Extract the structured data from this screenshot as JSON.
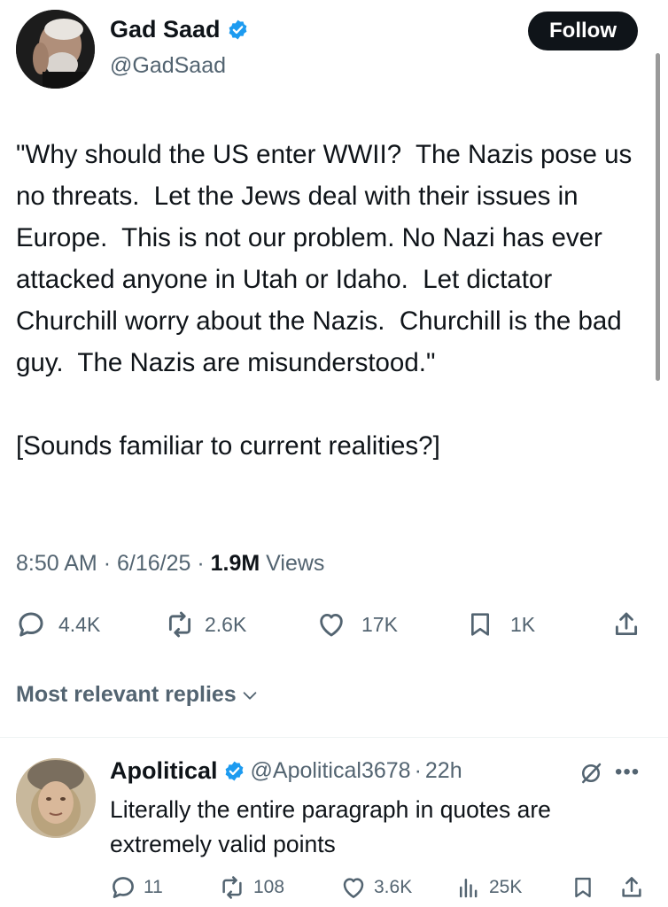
{
  "tweet": {
    "author": {
      "display_name": "Gad Saad",
      "handle": "@GadSaad"
    },
    "follow_label": "Follow",
    "text": "\"Why should the US enter WWII?  The Nazis pose us no threats.  Let the Jews deal with their issues in Europe.  This is not our problem. No Nazi has ever attacked anyone in Utah or Idaho.  Let dictator Churchill worry about the Nazis.  Churchill is the bad guy.  The Nazis are misunderstood.\"\n\n[Sounds familiar to current realities?]",
    "time": "8:50 AM",
    "date": "6/16/25",
    "views_count": "1.9M",
    "views_label": "Views",
    "stats": {
      "replies": "4.4K",
      "reposts": "2.6K",
      "likes": "17K",
      "bookmarks": "1K"
    }
  },
  "replies_sort_label": "Most relevant replies",
  "reply": {
    "display_name": "Apolitical",
    "handle": "@Apolitical3678",
    "time": "22h",
    "text": "Literally the entire paragraph in quotes are extremely valid points",
    "stats": {
      "replies": "11",
      "reposts": "108",
      "likes": "3.6K",
      "views": "25K"
    }
  },
  "colors": {
    "text": "#0f1419",
    "secondary": "#536471",
    "verified": "#1d9bf0",
    "button": "#0f1419"
  }
}
